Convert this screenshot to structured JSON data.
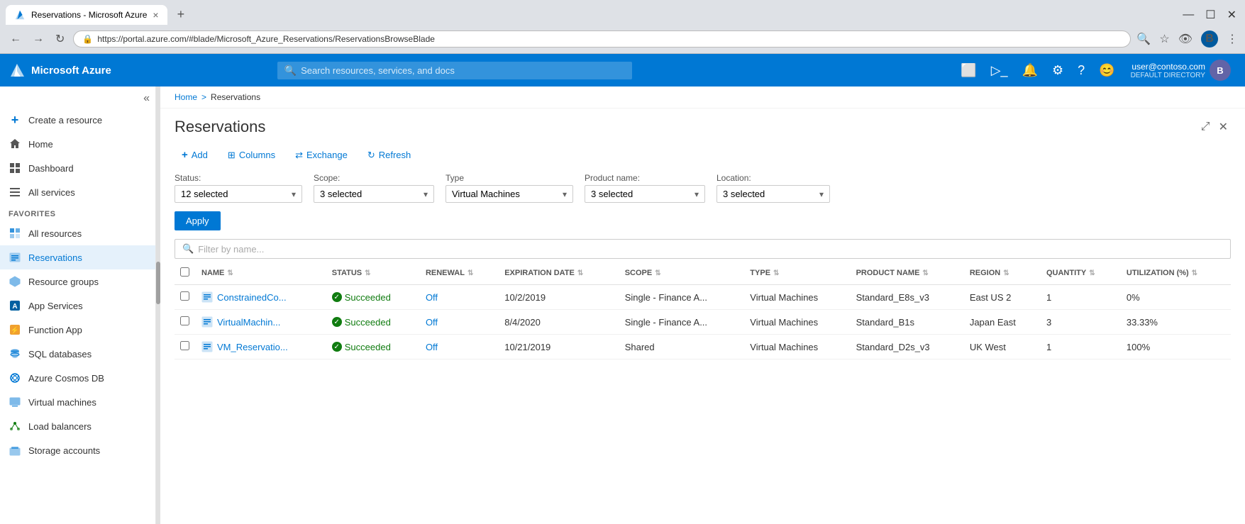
{
  "browser": {
    "tab_title": "Reservations - Microsoft Azure",
    "tab_close": "×",
    "new_tab": "+",
    "url": "https://portal.azure.com/#blade/Microsoft_Azure_Reservations/ReservationsBrowseBlade",
    "window_minimize": "—",
    "window_maximize": "☐",
    "window_close": "✕",
    "nav_back": "←",
    "nav_forward": "→",
    "nav_refresh": "↻",
    "lock_icon": "🔒"
  },
  "topbar": {
    "logo_text": "Microsoft Azure",
    "search_placeholder": "Search resources, services, and docs",
    "user_email": "user@contoso.com",
    "user_directory": "DEFAULT DIRECTORY",
    "user_initial": "B"
  },
  "breadcrumb": {
    "home": "Home",
    "separator": ">",
    "current": "Reservations"
  },
  "page": {
    "title": "Reservations",
    "close_icon": "✕",
    "popout_icon": "⤢"
  },
  "toolbar": {
    "add_label": "Add",
    "columns_label": "Columns",
    "exchange_label": "Exchange",
    "refresh_label": "Refresh"
  },
  "filters": {
    "status_label": "Status:",
    "status_value": "12 selected",
    "scope_label": "Scope:",
    "scope_value": "3 selected",
    "type_label": "Type",
    "type_value": "Virtual Machines",
    "product_name_label": "Product name:",
    "product_name_value": "3 selected",
    "location_label": "Location:",
    "location_value": "3 selected",
    "apply_label": "Apply",
    "filter_placeholder": "Filter by name..."
  },
  "table": {
    "columns": [
      {
        "key": "name",
        "label": "NAME"
      },
      {
        "key": "status",
        "label": "STATUS"
      },
      {
        "key": "renewal",
        "label": "RENEWAL"
      },
      {
        "key": "expiration_date",
        "label": "EXPIRATION DATE"
      },
      {
        "key": "scope",
        "label": "SCOPE"
      },
      {
        "key": "type",
        "label": "TYPE"
      },
      {
        "key": "product_name",
        "label": "PRODUCT NAME"
      },
      {
        "key": "region",
        "label": "REGION"
      },
      {
        "key": "quantity",
        "label": "QUANTITY"
      },
      {
        "key": "utilization",
        "label": "UTILIZATION (%)"
      }
    ],
    "rows": [
      {
        "name": "ConstrainedCo...",
        "status": "Succeeded",
        "renewal": "Off",
        "expiration_date": "10/2/2019",
        "scope": "Single - Finance A...",
        "type": "Virtual Machines",
        "product_name": "Standard_E8s_v3",
        "region": "East US 2",
        "quantity": "1",
        "utilization": "0%"
      },
      {
        "name": "VirtualMachin...",
        "status": "Succeeded",
        "renewal": "Off",
        "expiration_date": "8/4/2020",
        "scope": "Single - Finance A...",
        "type": "Virtual Machines",
        "product_name": "Standard_B1s",
        "region": "Japan East",
        "quantity": "3",
        "utilization": "33.33%"
      },
      {
        "name": "VM_Reservatio...",
        "status": "Succeeded",
        "renewal": "Off",
        "expiration_date": "10/21/2019",
        "scope": "Shared",
        "type": "Virtual Machines",
        "product_name": "Standard_D2s_v3",
        "region": "UK West",
        "quantity": "1",
        "utilization": "100%"
      }
    ]
  },
  "sidebar": {
    "collapse_icon": "«",
    "items": [
      {
        "id": "create-resource",
        "label": "Create a resource",
        "icon": "+",
        "type": "action"
      },
      {
        "id": "home",
        "label": "Home",
        "icon": "⌂"
      },
      {
        "id": "dashboard",
        "label": "Dashboard",
        "icon": "▦"
      },
      {
        "id": "all-services",
        "label": "All services",
        "icon": "≡"
      },
      {
        "id": "favorites-header",
        "label": "FAVORITES",
        "type": "section"
      },
      {
        "id": "all-resources",
        "label": "All resources",
        "icon": "▣"
      },
      {
        "id": "reservations",
        "label": "Reservations",
        "icon": "📋",
        "active": true
      },
      {
        "id": "resource-groups",
        "label": "Resource groups",
        "icon": "🔷"
      },
      {
        "id": "app-services",
        "label": "App Services",
        "icon": "⚡"
      },
      {
        "id": "function-app",
        "label": "Function App",
        "icon": "⚡"
      },
      {
        "id": "sql-databases",
        "label": "SQL databases",
        "icon": "🗄"
      },
      {
        "id": "azure-cosmos-db",
        "label": "Azure Cosmos DB",
        "icon": "🌐"
      },
      {
        "id": "virtual-machines",
        "label": "Virtual machines",
        "icon": "💻"
      },
      {
        "id": "load-balancers",
        "label": "Load balancers",
        "icon": "⚖"
      },
      {
        "id": "storage-accounts",
        "label": "Storage accounts",
        "icon": "💾"
      }
    ]
  }
}
